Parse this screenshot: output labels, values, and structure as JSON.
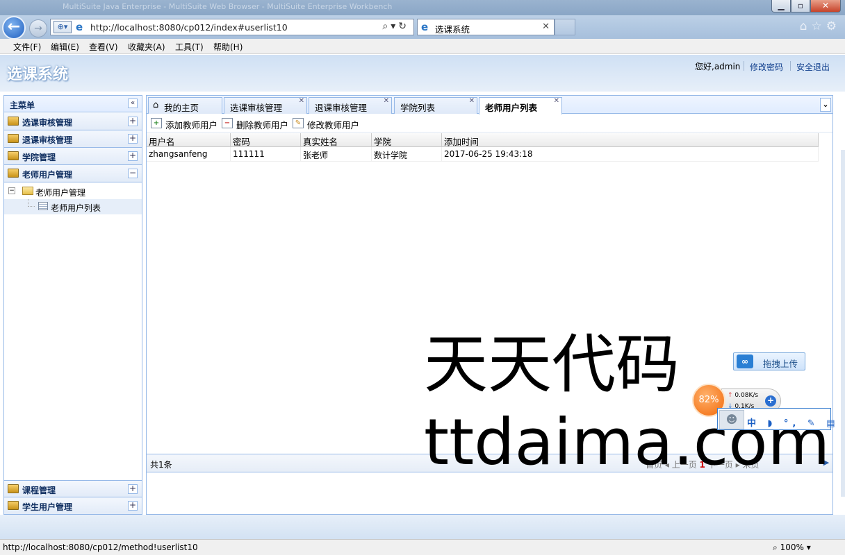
{
  "browser": {
    "window_title": "MultiSuite Java Enterprise - MultiSuite Web Browser - MultiSuite Enterprise Workbench",
    "address_url": "http://localhost:8080/cp012/index#userlist10",
    "tab_title": "选课系统",
    "window_buttons": {
      "minimize": "▁",
      "maximize": "▫",
      "close": "✕"
    },
    "menu": [
      "文件(F)",
      "编辑(E)",
      "查看(V)",
      "收藏夹(A)",
      "工具(T)",
      "帮助(H)"
    ],
    "status_url": "http://localhost:8080/cp012/method!userlist10",
    "zoom": "100%"
  },
  "app": {
    "title": "选课系统",
    "greeting": "您好,admin",
    "change_password": "修改密码",
    "logout": "安全退出"
  },
  "sidebar": {
    "title": "主菜单",
    "sections": [
      {
        "label": "选课审核管理",
        "expanded": false
      },
      {
        "label": "退课审核管理",
        "expanded": false
      },
      {
        "label": "学院管理",
        "expanded": false
      },
      {
        "label": "老师用户管理",
        "expanded": true
      },
      {
        "label": "课程管理",
        "expanded": false
      },
      {
        "label": "学生用户管理",
        "expanded": false
      }
    ],
    "tree": {
      "folder": "老师用户管理",
      "leaf": "老师用户列表"
    }
  },
  "tabs": [
    {
      "label": "我的主页",
      "closable": false,
      "selected": false
    },
    {
      "label": "选课审核管理",
      "closable": true,
      "selected": false
    },
    {
      "label": "退课审核管理",
      "closable": true,
      "selected": false
    },
    {
      "label": "学院列表",
      "closable": true,
      "selected": false
    },
    {
      "label": "老师用户列表",
      "closable": true,
      "selected": true
    }
  ],
  "toolbar": {
    "add": "添加教师用户",
    "delete": "删除教师用户",
    "edit": "修改教师用户"
  },
  "grid": {
    "columns": [
      "用户名",
      "密码",
      "真实姓名",
      "学院",
      "添加时间"
    ],
    "rows": [
      [
        "zhangsanfeng",
        "111111",
        "张老师",
        "数计学院",
        "2017-06-25 19:43:18"
      ]
    ]
  },
  "pager": {
    "total": "共1条",
    "first": "首页",
    "prev": "上一页",
    "current": "1",
    "next": "下一页",
    "last": "末页"
  },
  "overlays": {
    "watermark_line1": "天天代码",
    "watermark_line2": "ttdaima.com",
    "upload_button": "拖拽上传",
    "speed_percent": "82%",
    "speed_up": "0.08K/s",
    "speed_down": "0.1K/s",
    "ime_keys": "中 ◗ °, ✎ ▤ ☺"
  },
  "colors": {
    "border": "#95b8e7",
    "header_text": "#0e2d5f",
    "link": "#0e3d8c",
    "pager_current": "#cc0000"
  }
}
